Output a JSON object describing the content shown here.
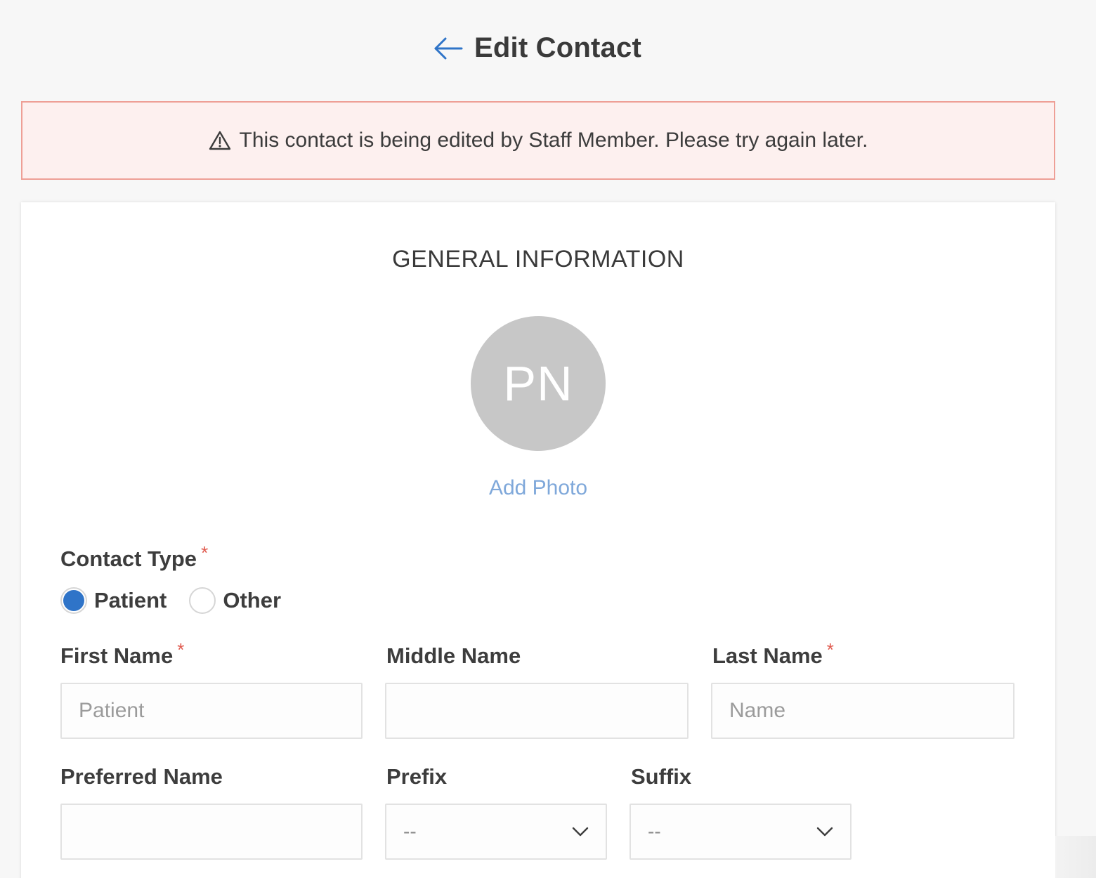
{
  "header": {
    "title": "Edit Contact",
    "back_icon": "arrow-left-icon"
  },
  "alert": {
    "icon": "warning-triangle-icon",
    "text": "This contact is being edited by Staff Member. Please try again later.",
    "border_color": "#ee9f96",
    "background_color": "#fdf0ef"
  },
  "general": {
    "section_title": "GENERAL INFORMATION",
    "avatar_initials": "PN",
    "add_photo": "Add Photo"
  },
  "contact_type": {
    "label": "Contact Type",
    "required_mark": "*",
    "options": [
      {
        "label": "Patient",
        "checked": true
      },
      {
        "label": "Other",
        "checked": false
      }
    ]
  },
  "fields": {
    "first_name": {
      "label": "First Name",
      "required_mark": "*",
      "placeholder": "Patient",
      "value": ""
    },
    "middle_name": {
      "label": "Middle Name",
      "placeholder": "",
      "value": ""
    },
    "last_name": {
      "label": "Last Name",
      "required_mark": "*",
      "placeholder": "Name",
      "value": ""
    },
    "preferred_name": {
      "label": "Preferred Name",
      "placeholder": "",
      "value": ""
    },
    "prefix": {
      "label": "Prefix",
      "selected": "--"
    },
    "suffix": {
      "label": "Suffix",
      "selected": "--"
    }
  },
  "colors": {
    "accent": "#2f74c8",
    "link": "#7fa8da",
    "required": "#e05a4e"
  }
}
